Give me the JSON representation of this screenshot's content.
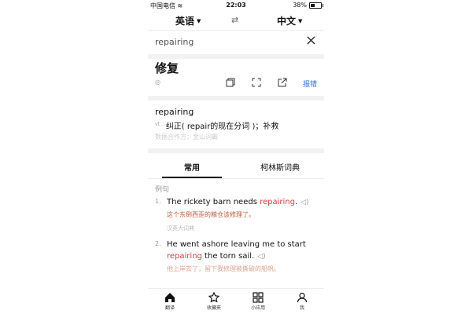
{
  "status_bar": {
    "carrier": "中国电信",
    "time": "22:03",
    "battery": "38%",
    "battery_level": 0.38
  },
  "lang_bar": {
    "source": "英语",
    "target": "中文"
  },
  "search": {
    "query": "repairing"
  },
  "result": {
    "translation": "修复",
    "report_label": "报错"
  },
  "definitions": {
    "headword": "repairing",
    "pos": "vt.",
    "meaning": "纠正( repair的现在分词 )；补救",
    "source": "数据合作方：金山词霸"
  },
  "tabs": [
    "常用",
    "柯林斯词典"
  ],
  "examples": {
    "label": "例句",
    "items": [
      {
        "num": "1.",
        "en_before": "The rickety barn needs ",
        "en_hl": "repairing",
        "en_after": ".",
        "zh": "这个东倒西歪的粮仓该修理了。",
        "source": "汉英大词典"
      },
      {
        "num": "2.",
        "en_before": "He went ashore leaving me to start ",
        "en_hl": "repairing",
        "en_after": " the torn sail.",
        "zh": "他上岸去了，留下我修理被撕破的船帆。"
      }
    ]
  },
  "bottom_nav": [
    {
      "label": "翻译",
      "icon": "home-icon"
    },
    {
      "label": "收藏夹",
      "icon": "star-icon"
    },
    {
      "label": "小应用",
      "icon": "apps-grid-icon"
    },
    {
      "label": "我",
      "icon": "person-icon"
    }
  ],
  "colors": {
    "accent": "#2b6fe0",
    "highlight": "#e04040"
  }
}
